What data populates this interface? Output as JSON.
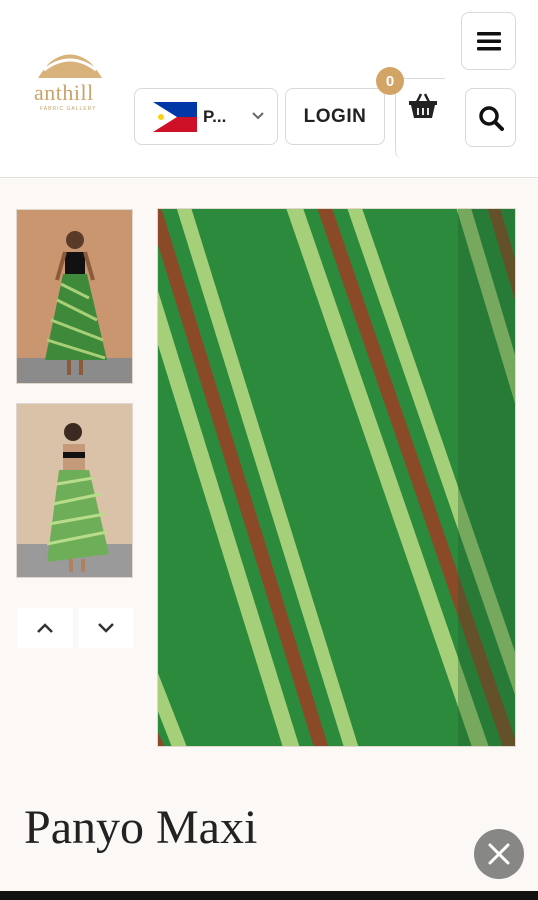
{
  "brand": {
    "name": "anthill",
    "tagline": "FABRIC GALLERY",
    "color": "#c9a36a"
  },
  "header": {
    "country": {
      "code": "P...",
      "flag_icon": "philippines-flag-icon"
    },
    "login_label": "LOGIN",
    "cart": {
      "count": "0",
      "icon": "basket-icon",
      "badge_color": "#d2a566"
    },
    "menu_icon": "hamburger-menu-icon",
    "search_icon": "search-icon"
  },
  "gallery": {
    "thumbnails": [
      {
        "alt": "model-front-view"
      },
      {
        "alt": "model-back-view"
      }
    ],
    "nav": {
      "up_icon": "chevron-up-icon",
      "down_icon": "chevron-down-icon"
    },
    "fabric_colors": {
      "base": "#2a8a3a",
      "stripe_light": "#a8d07a",
      "stripe_brown": "#8a4a28"
    }
  },
  "product": {
    "title": "Panyo Maxi"
  },
  "overlay": {
    "close_icon": "close-icon"
  }
}
